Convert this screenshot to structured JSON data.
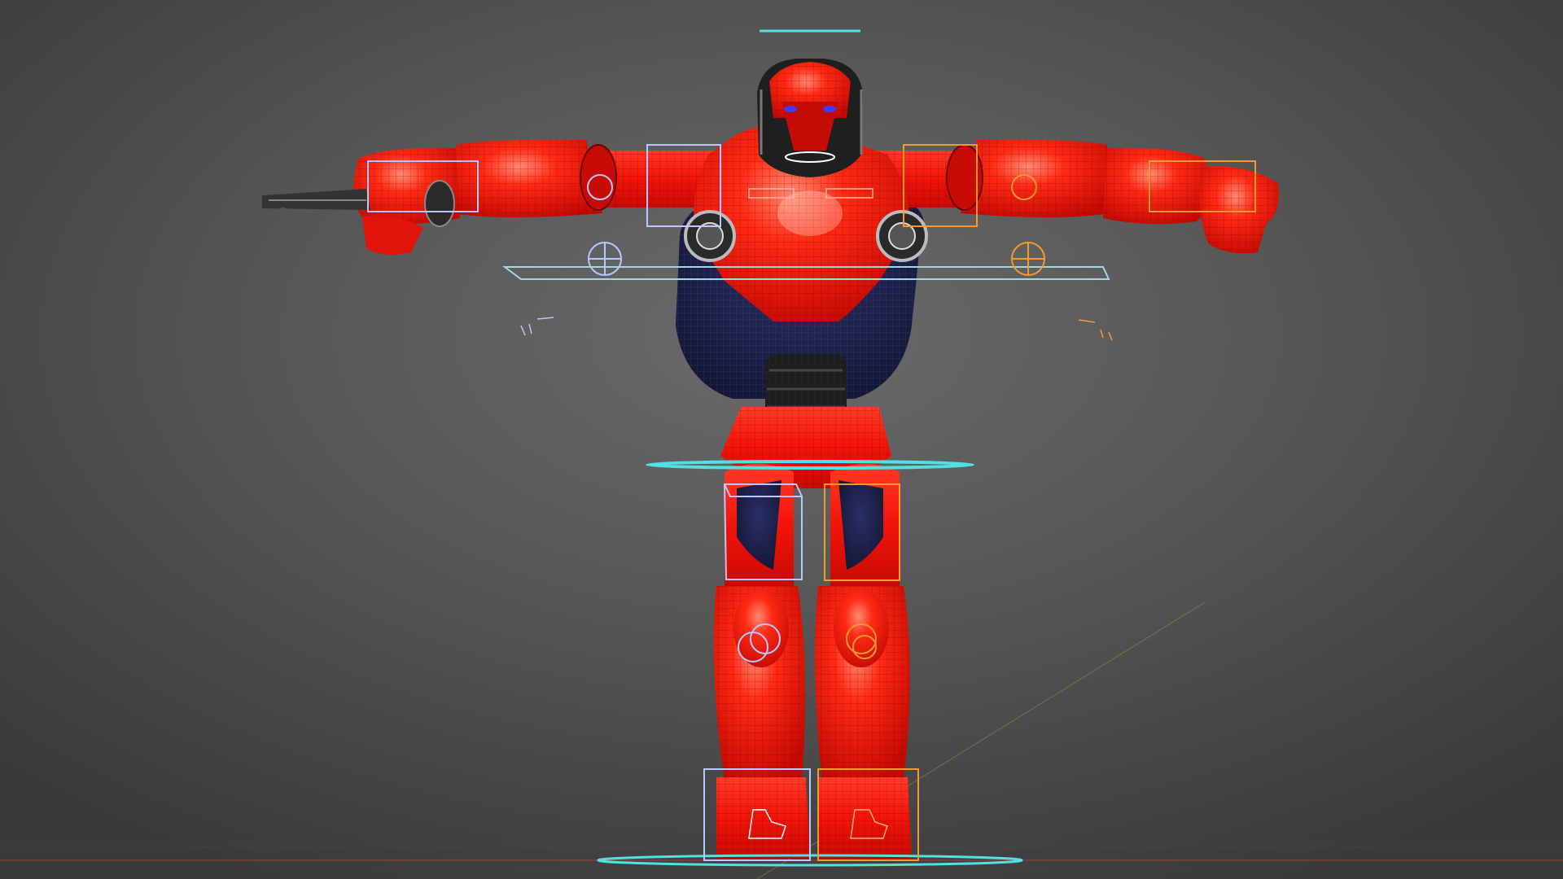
{
  "viewport": {
    "kind": "3d-viewport",
    "background_color": "#5b5b5b",
    "mesh_color": "#ff1a0e",
    "mesh_dark_color": "#1c1f44",
    "wire_color": "#7a0000",
    "rig_left_color": "#b9c6ff",
    "rig_right_color": "#f29a2e",
    "rig_center_color": "#52e0e0",
    "axis_x_color": "#b04040",
    "axis_y_color": "#9a8a40"
  },
  "scene": {
    "model": "red-robot-mesh",
    "pose": "T-pose",
    "shading": "solid-with-wireframe-overlay",
    "rig_visible": true
  }
}
